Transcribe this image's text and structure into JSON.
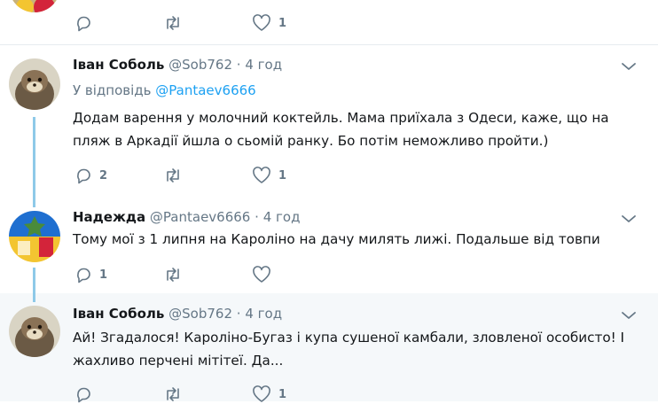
{
  "top_actions": {
    "reply_count": "",
    "retweet_count": "",
    "like_count": "1"
  },
  "tweets": [
    {
      "name": "Іван Соболь",
      "handle": "@Sob762",
      "dot": "·",
      "time": "4 год",
      "reply_prefix": "У відповідь",
      "reply_mention": "@Pantaev6666",
      "text": "Додам варення у молочний коктейль. Мама приїхала з Одеси, каже, що на пляж в Аркадії йшла о сьомій ранку. Бо потім неможливо пройти.)",
      "reply_count": "2",
      "retweet_count": "",
      "like_count": "1"
    },
    {
      "name": "Надежда",
      "handle": "@Pantaev6666",
      "dot": "·",
      "time": "4 год",
      "text": "Тому мої з 1 липня на Кароліно на дачу милять лижі. Подальше від товпи",
      "reply_count": "1",
      "retweet_count": "",
      "like_count": ""
    },
    {
      "name": "Іван Соболь",
      "handle": "@Sob762",
      "dot": "·",
      "time": "4 год",
      "text": "Ай! Згадалося! Кароліно-Бугаз і купа сушеної камбали, зловленої особисто! І жахливо перчені мітітеї. Да...",
      "reply_count": "",
      "retweet_count": "",
      "like_count": "1"
    }
  ],
  "colors": {
    "accent": "#1da1f2",
    "muted": "#657786",
    "thread": "#8ec9e8",
    "highlight": "#f5f8fa"
  }
}
